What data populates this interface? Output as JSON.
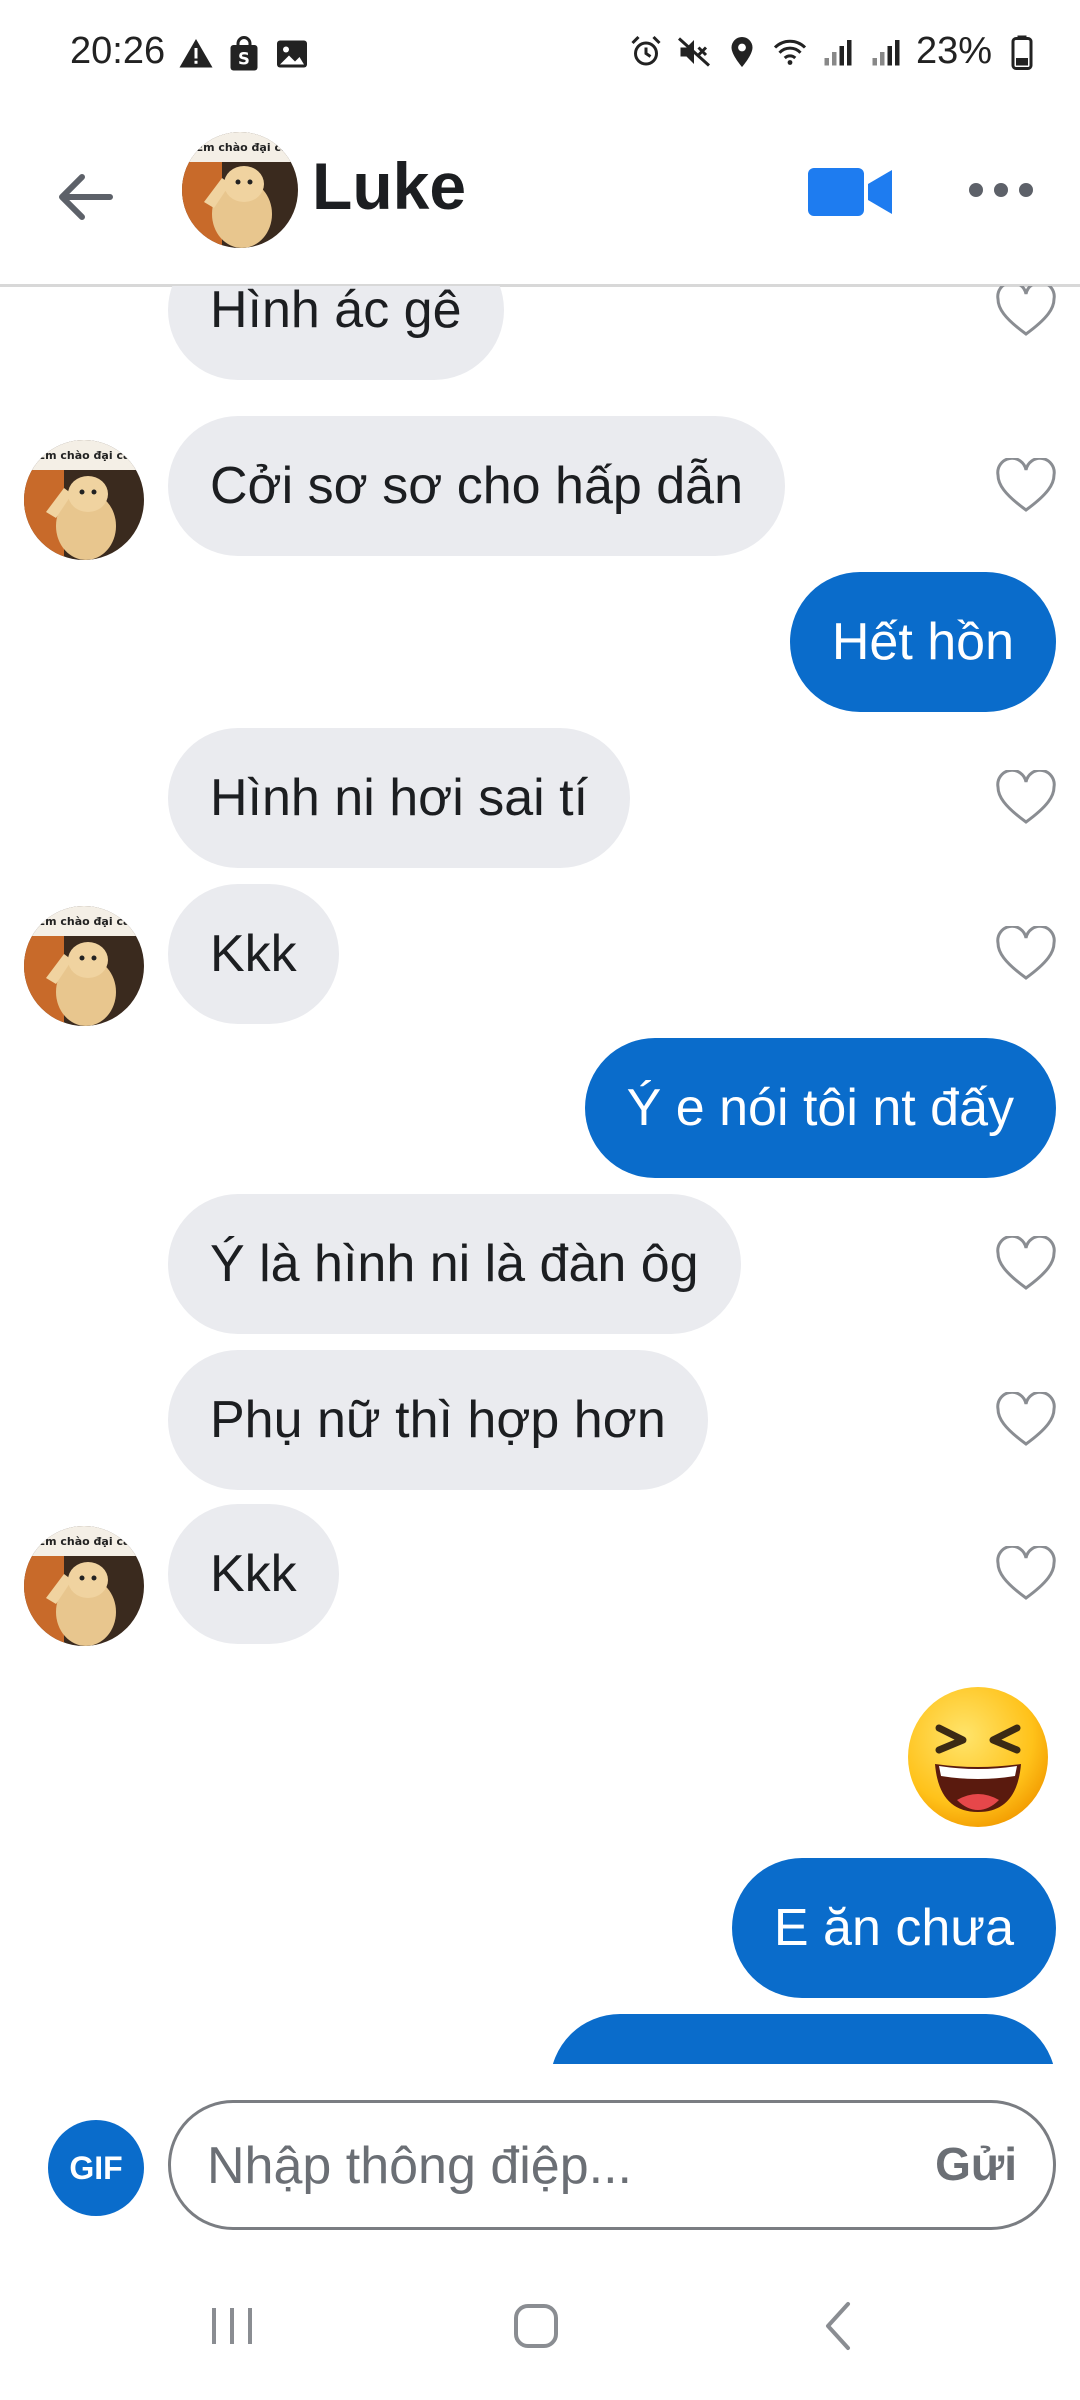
{
  "status_bar": {
    "time": "20:26",
    "battery": "23%",
    "left_icons": [
      "warning-icon",
      "shopping-bag-icon",
      "image-icon"
    ],
    "right_icons": [
      "alarm-icon",
      "mute-icon",
      "location-icon",
      "wifi-icon",
      "signal-icon",
      "signal-icon",
      "battery-icon"
    ]
  },
  "header": {
    "contact_name": "Luke",
    "avatar_caption": "Em chào đại ca",
    "icons": [
      "back-arrow-icon",
      "video-call-icon",
      "more-icon"
    ]
  },
  "messages": [
    {
      "dir": "in",
      "text": "Hình ác gê",
      "heart": true,
      "avatar": false
    },
    {
      "dir": "in",
      "text": "Cởi sơ sơ cho hấp dẫn",
      "heart": true,
      "avatar": true
    },
    {
      "dir": "out",
      "text": "Hết hồn"
    },
    {
      "dir": "in",
      "text": "Hình ni hơi sai tí",
      "heart": true,
      "avatar": false
    },
    {
      "dir": "in",
      "text": "Kkk",
      "heart": true,
      "avatar": true
    },
    {
      "dir": "out",
      "text": "Ý e nói tôi nt đấy"
    },
    {
      "dir": "in",
      "text": "Ý là hình ni là đàn ôg",
      "heart": true,
      "avatar": false
    },
    {
      "dir": "in",
      "text": "Phụ nữ thì hợp hơn",
      "heart": true,
      "avatar": false
    },
    {
      "dir": "in",
      "text": "Kkk",
      "heart": true,
      "avatar": true
    },
    {
      "dir": "out",
      "emoji": "laughing-face-emoji"
    },
    {
      "dir": "out",
      "text": "E ăn chưa"
    }
  ],
  "composer": {
    "gif_label": "GIF",
    "placeholder": "Nhập thông điệp...",
    "send_label": "Gửi"
  },
  "nav_bar": {
    "icons": [
      "recent-apps-icon",
      "home-icon",
      "back-icon"
    ]
  },
  "colors": {
    "accent": "#0a6ccb",
    "incoming_bubble": "#eaebef",
    "text": "#1c1e21"
  }
}
